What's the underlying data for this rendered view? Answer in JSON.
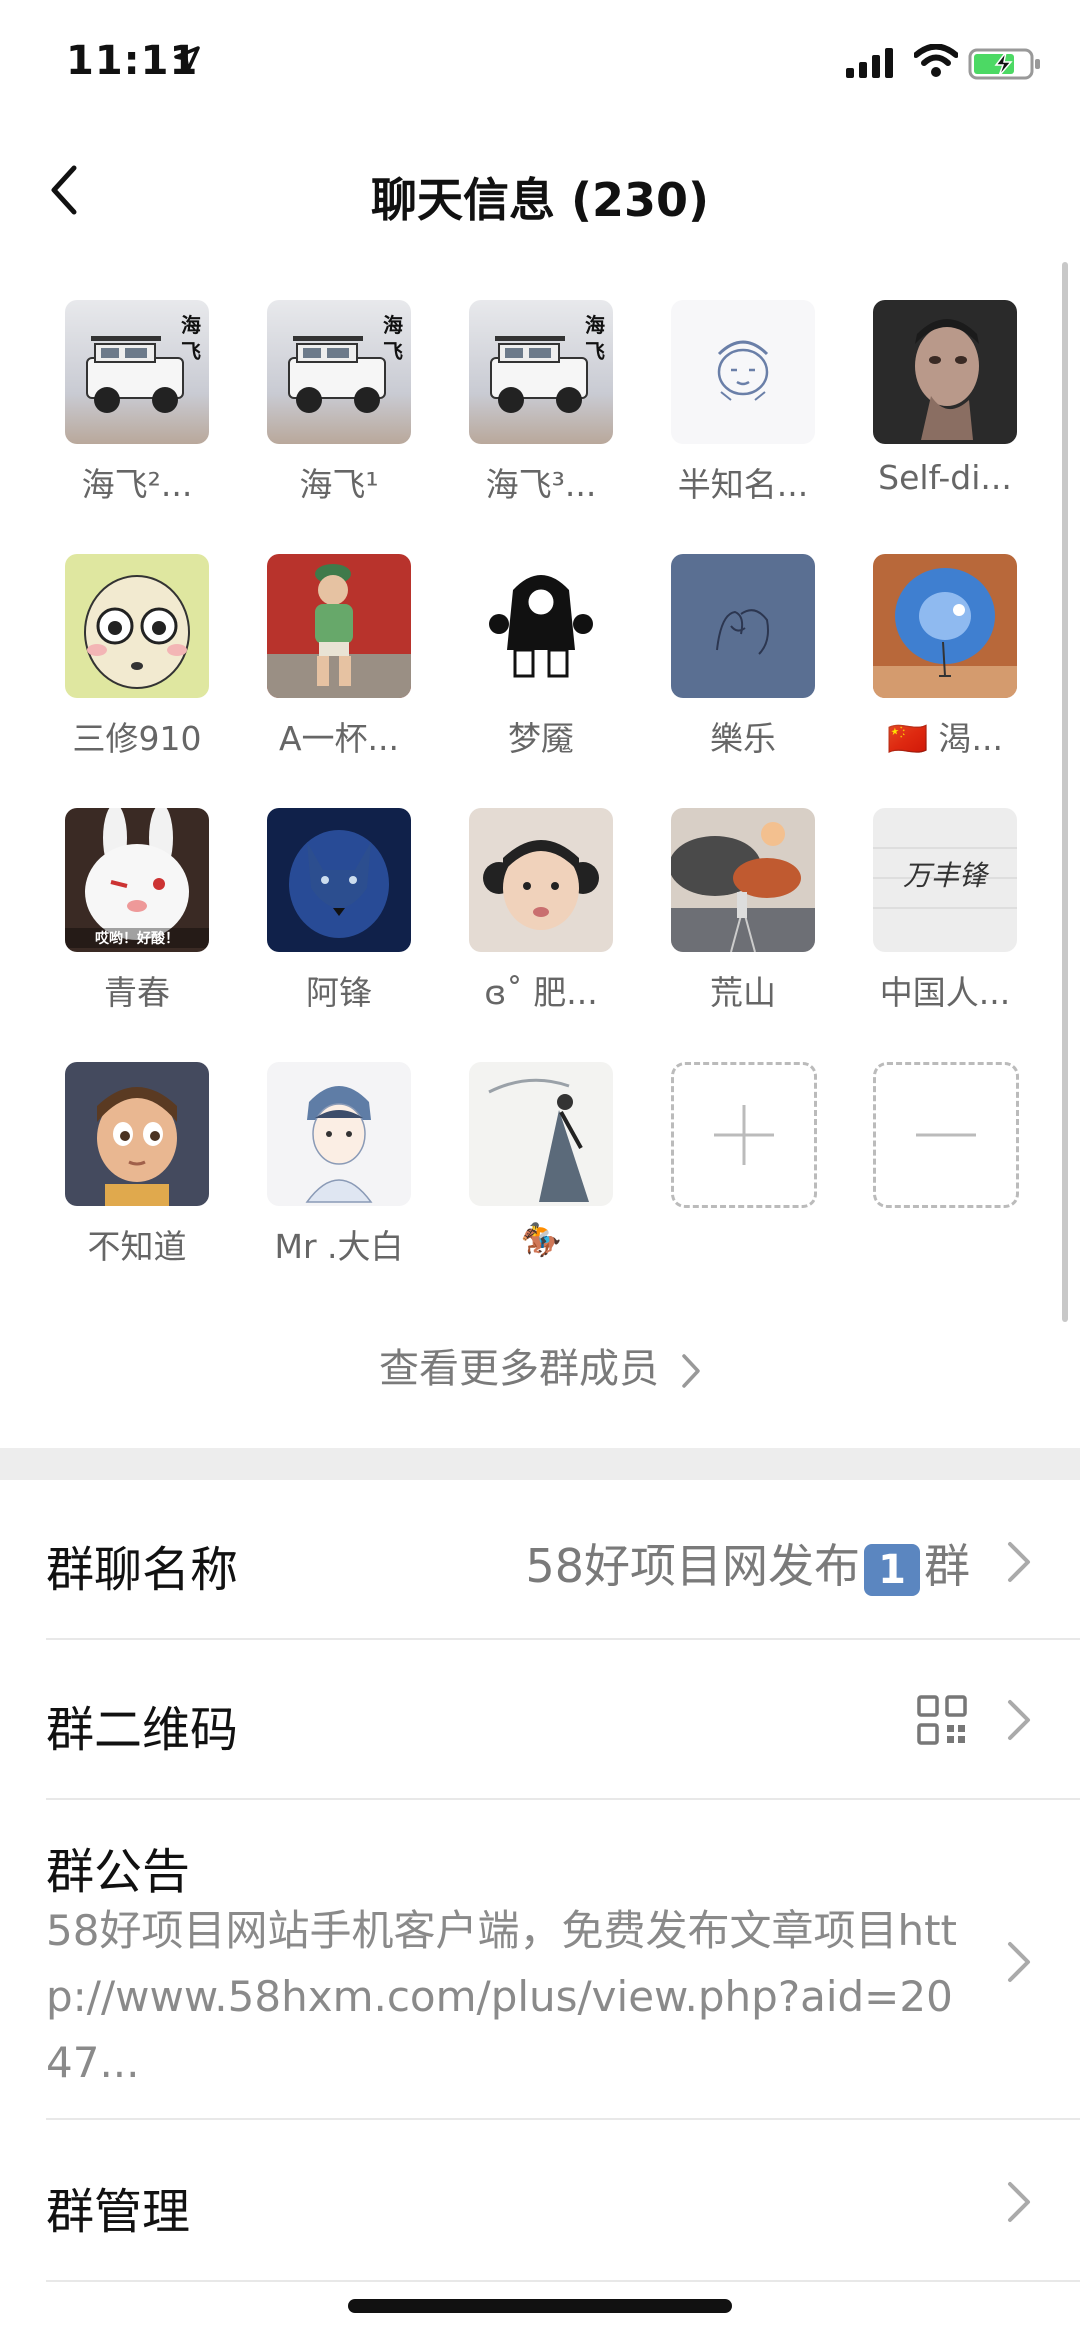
{
  "status_bar": {
    "time": "11:11"
  },
  "nav": {
    "title": "聊天信息 (230)"
  },
  "members": [
    {
      "name": "海飞²...",
      "avatar": "jeep-avatar",
      "text": "海\n飞"
    },
    {
      "name": "海飞¹",
      "avatar": "jeep-avatar",
      "text": "海\n飞"
    },
    {
      "name": "海飞³...",
      "avatar": "jeep-avatar",
      "text": "海\n飞"
    },
    {
      "name": "半知名...",
      "avatar": "sketch-face-avatar"
    },
    {
      "name": "Self-di...",
      "avatar": "man-portrait-avatar"
    },
    {
      "name": "三修910",
      "avatar": "cartoon-bald-avatar"
    },
    {
      "name": "A一杯...",
      "avatar": "child-photo-avatar"
    },
    {
      "name": "梦魇",
      "avatar": "cartoon-figure-avatar"
    },
    {
      "name": "樂乐",
      "avatar": "blue-sketch-avatar"
    },
    {
      "name": "🇨🇳 渴...",
      "avatar": "cave-sky-avatar"
    },
    {
      "name": "青春",
      "avatar": "white-rabbit-avatar",
      "text": "哎哟！好酸！"
    },
    {
      "name": "阿锋",
      "avatar": "wolf-avatar"
    },
    {
      "name": "ɞ˚ 肥...",
      "avatar": "girl-photo-avatar"
    },
    {
      "name": "荒山",
      "avatar": "smoke-scene-avatar"
    },
    {
      "name": "中国人...",
      "avatar": "handwriting-avatar",
      "text": "万丰锋"
    },
    {
      "name": "不知道",
      "avatar": "cartoon-boy-avatar"
    },
    {
      "name": "Mr .大白",
      "avatar": "anime-boy-avatar"
    },
    {
      "name": "🏇",
      "avatar": "ink-painting-avatar"
    }
  ],
  "more_members_label": "查看更多群成员",
  "settings": {
    "group_name_label": "群聊名称",
    "group_name_prefix": "58好项目网发布",
    "group_name_badge": "1",
    "group_name_suffix": "群",
    "qr_label": "群二维码",
    "announcement_label": "群公告",
    "announcement_text": "58好项目网站手机客户端，免费发布文章项目http://www.58hxm.com/plus/view.php?aid=2047...",
    "manage_label": "群管理"
  }
}
